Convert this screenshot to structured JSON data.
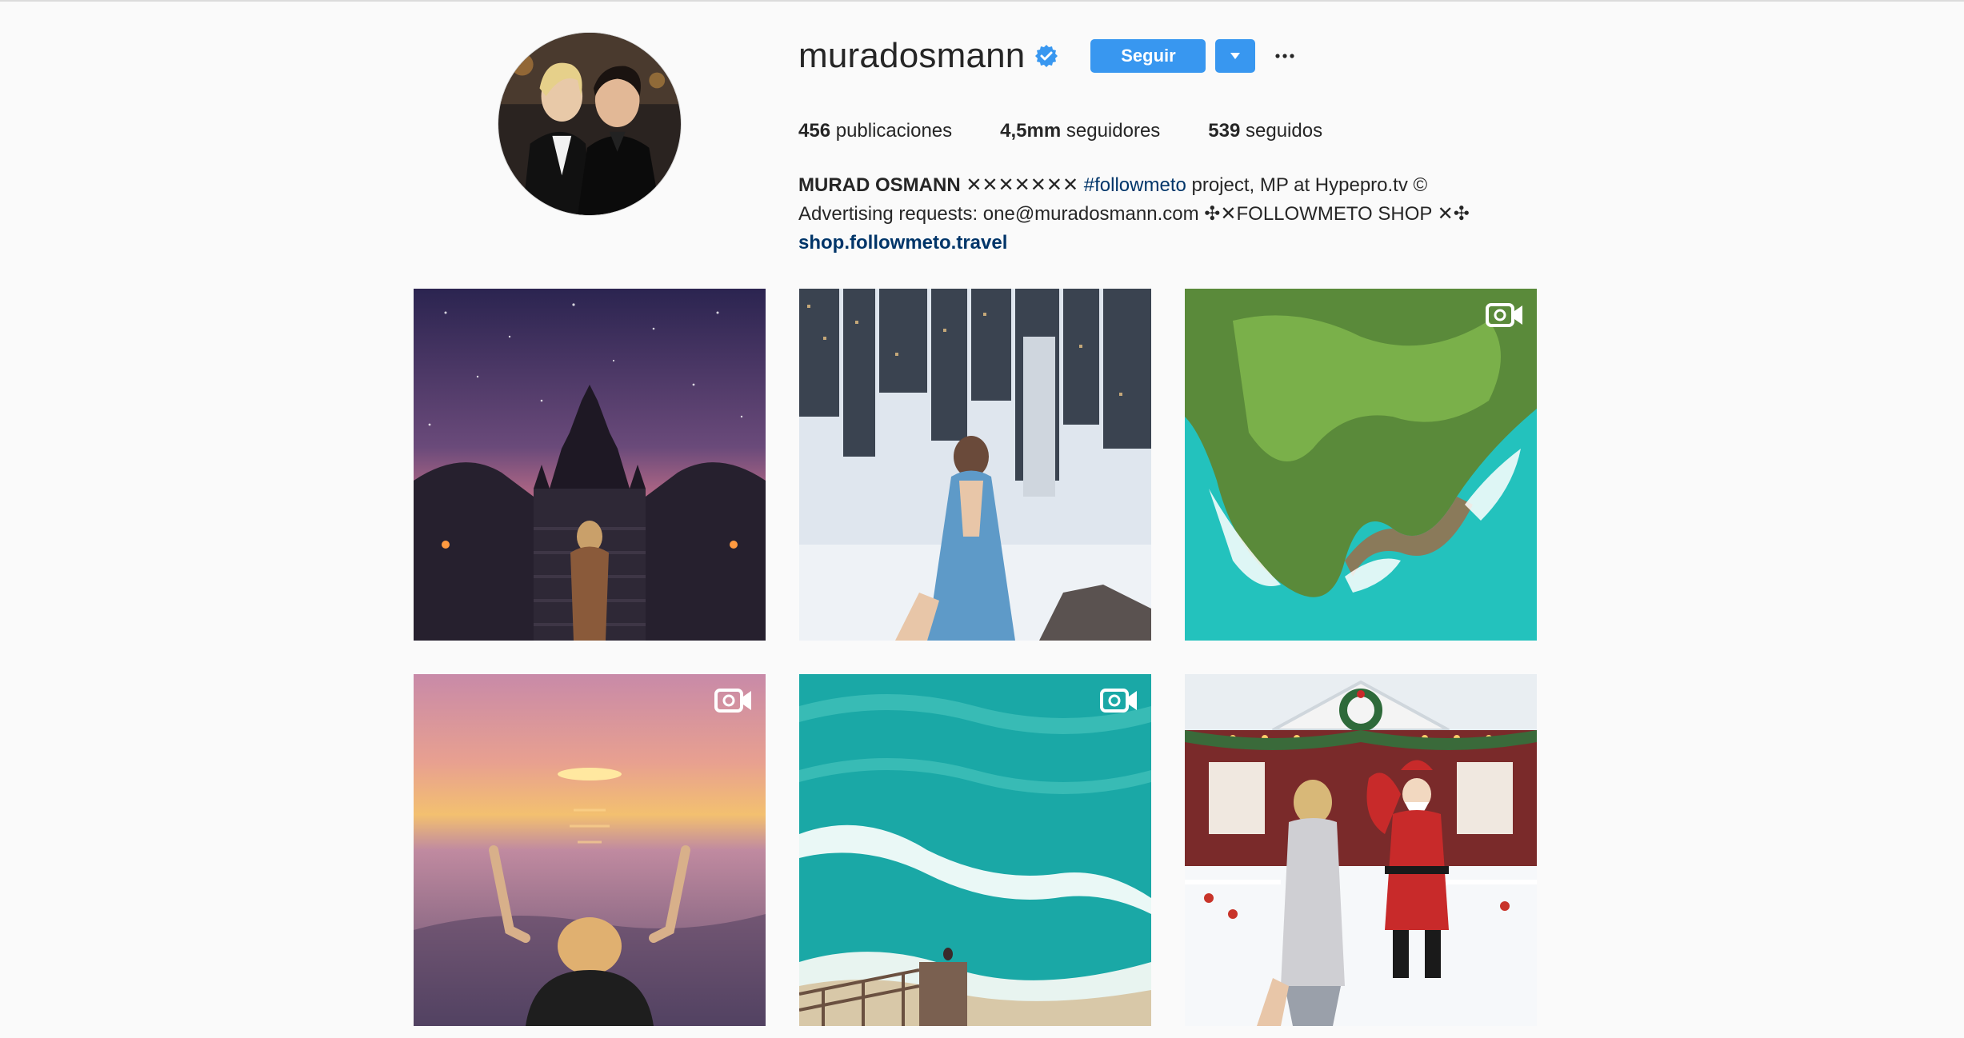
{
  "profile": {
    "username": "muradosmann",
    "verified_icon": "verified-badge-icon",
    "follow_label": "Seguir",
    "stats": {
      "posts_count": "456",
      "posts_label": "publicaciones",
      "followers_count": "4,5mm",
      "followers_label": "seguidores",
      "following_count": "539",
      "following_label": "seguidos"
    },
    "bio": {
      "name": "MURAD OSMANN",
      "line1_symbols": " ✕✕✕✕✕✕✕ ",
      "hashtag": "#followmeto",
      "line1_rest": " project, MP at Hypepro.tv ©",
      "line2": "Advertising requests: one@muradosmann.com ✣✕FOLLOWMETO SHOP ✕✣",
      "website": "shop.followmeto.travel"
    }
  },
  "colors": {
    "accent": "#3897f0",
    "link": "#003569",
    "background": "#fafafa",
    "text": "#262626"
  },
  "posts": [
    {
      "id": "post-1",
      "type": "photo",
      "subject": "temple-starry-sky"
    },
    {
      "id": "post-2",
      "type": "photo",
      "subject": "inverted-city-blue-dress"
    },
    {
      "id": "post-3",
      "type": "video",
      "subject": "aerial-green-cliffs-turquoise-sea"
    },
    {
      "id": "post-4",
      "type": "video",
      "subject": "sunset-sea-raised-arms"
    },
    {
      "id": "post-5",
      "type": "video",
      "subject": "aerial-turquoise-waves-pier"
    },
    {
      "id": "post-6",
      "type": "photo",
      "subject": "christmas-house-santa"
    }
  ]
}
